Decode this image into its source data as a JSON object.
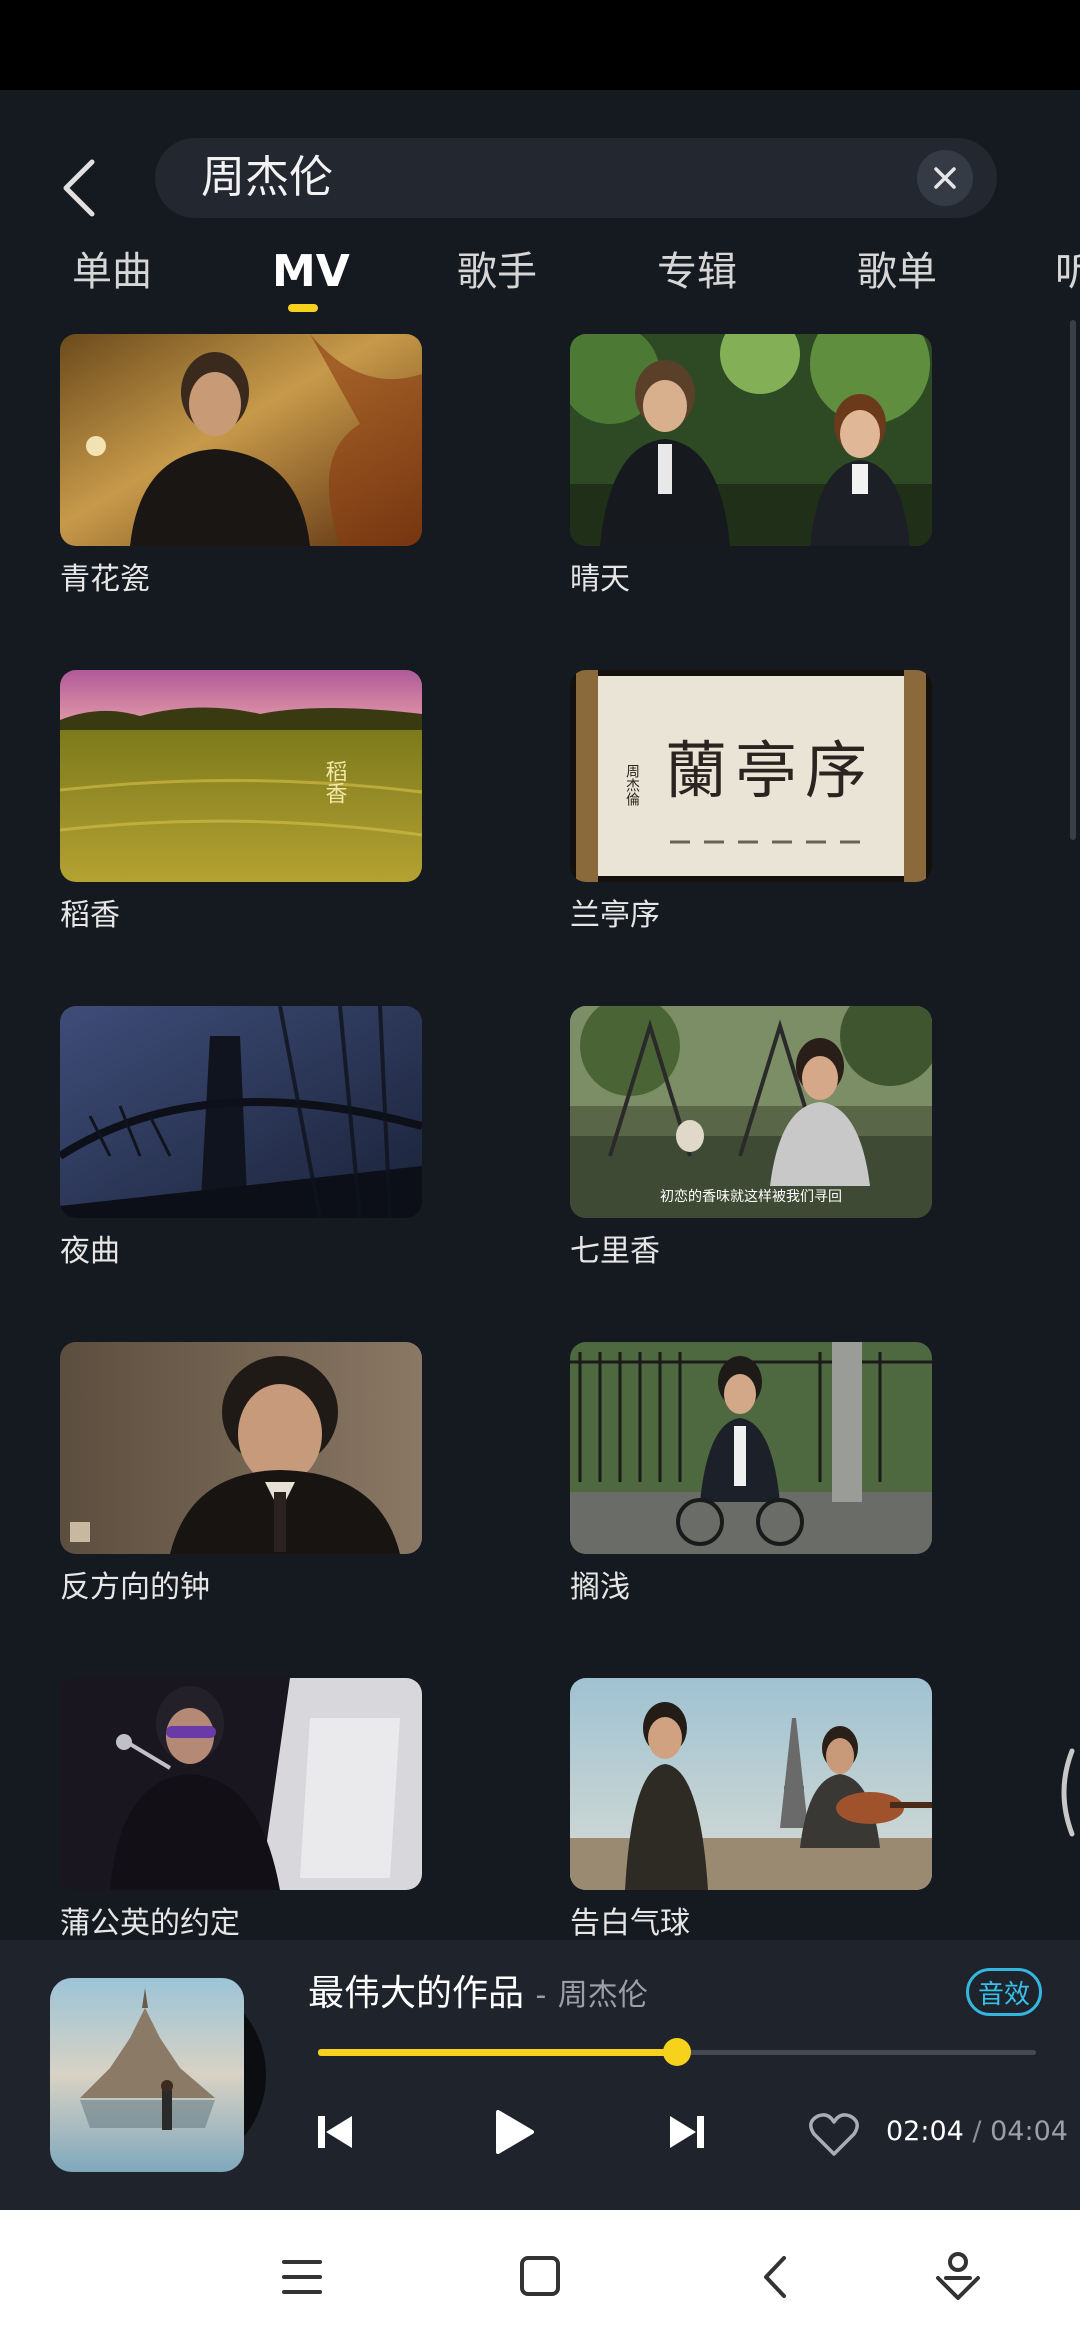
{
  "search": {
    "query": "周杰伦"
  },
  "tabs": [
    {
      "label": "单曲",
      "active": false
    },
    {
      "label": "MV",
      "active": true
    },
    {
      "label": "歌手",
      "active": false
    },
    {
      "label": "专辑",
      "active": false
    },
    {
      "label": "歌单",
      "active": false
    },
    {
      "label": "听",
      "active": false
    }
  ],
  "mv_list": [
    {
      "title": "青花瓷"
    },
    {
      "title": "晴天"
    },
    {
      "title": "稻香",
      "overlay_text": "稻香"
    },
    {
      "title": "兰亭序",
      "overlay_text": "蘭亭序",
      "overlay_sub": "周杰倫"
    },
    {
      "title": "夜曲"
    },
    {
      "title": "七里香",
      "overlay_text": "初恋的香味就这样被我们寻回"
    },
    {
      "title": "反方向的钟"
    },
    {
      "title": "搁浅"
    },
    {
      "title": "蒲公英的约定"
    },
    {
      "title": "告白气球"
    }
  ],
  "player": {
    "song_title": "最伟大的作品",
    "separator": "-",
    "artist": "周杰伦",
    "effect_badge": "音效",
    "progress_fraction": 0.5,
    "time_current": "02:04",
    "time_sep": "/",
    "time_total": "04:04",
    "accent_color": "#f6d21d"
  },
  "icons": {
    "back": "chevron-left-icon",
    "clear": "close-icon",
    "prev": "skip-previous-icon",
    "play": "play-icon",
    "next": "skip-next-icon",
    "favorite": "heart-outline-icon",
    "nav_menu": "menu-icon",
    "nav_home": "square-icon",
    "nav_back": "back-icon",
    "nav_assistant": "assistant-icon"
  }
}
